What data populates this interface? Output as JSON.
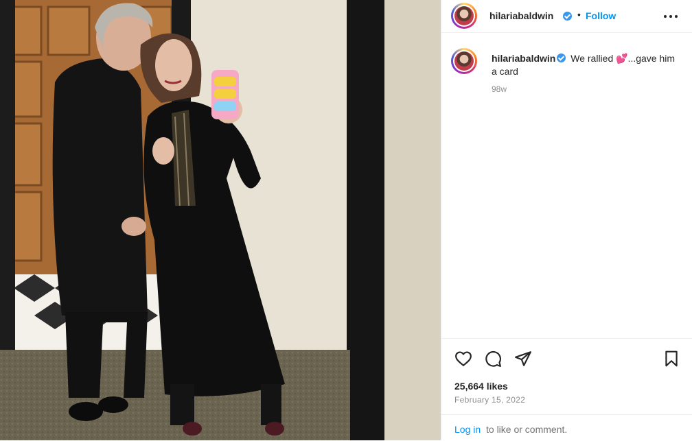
{
  "post": {
    "username": "hilariabaldwin",
    "follow_label": "Follow",
    "separator": "•",
    "caption": {
      "text": "We rallied 💕...gave him a card",
      "time_ago": "98w"
    },
    "likes": "25,664 likes",
    "date": "February 15, 2022",
    "login": {
      "link": "Log in",
      "rest": "to like or comment."
    }
  },
  "icons": {
    "more": "more-options-icon",
    "like": "heart-icon",
    "comment": "comment-icon",
    "share": "paper-plane-icon",
    "save": "bookmark-icon",
    "verified": "verified-badge-icon"
  },
  "colors": {
    "link": "#0095f6",
    "verified": "#3897f0",
    "muted": "#8e8e8e",
    "text": "#262626"
  }
}
